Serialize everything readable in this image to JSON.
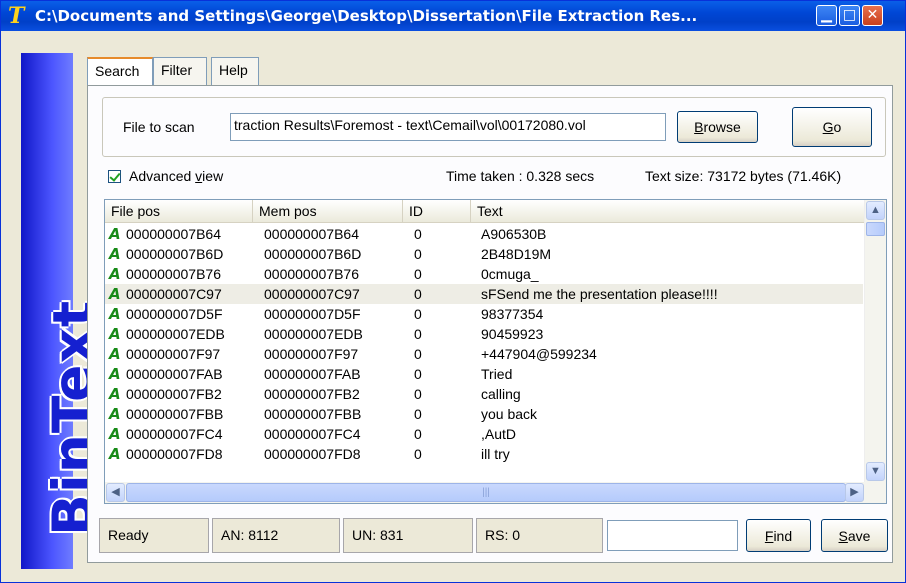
{
  "window": {
    "title": "C:\\Documents and Settings\\George\\Desktop\\Dissertation\\File Extraction Res...",
    "app_icon_glyph": "T",
    "controls": {
      "minimize": "▁",
      "maximize": "□",
      "close": "✕"
    }
  },
  "sidebar": {
    "brand": "BinText",
    "color": "#1520d0"
  },
  "tabs": [
    {
      "label": "Search",
      "active": true
    },
    {
      "label": "Filter",
      "active": false
    },
    {
      "label": "Help",
      "active": false
    }
  ],
  "scan": {
    "file_label": "File to scan",
    "file_value": "traction Results\\Foremost - text\\Cemail\\vol\\00172080.vol",
    "browse_label_u": "B",
    "browse_label_rest": "rowse",
    "go_label_u": "G",
    "go_label_rest": "o"
  },
  "options": {
    "advanced_view_pre": "Advanced ",
    "advanced_view_u": "v",
    "advanced_view_post": "iew",
    "advanced_view_checked": true,
    "time_taken": "Time taken : 0.328 secs",
    "text_size": "Text size: 73172 bytes (71.46K)"
  },
  "table": {
    "columns": [
      "File pos",
      "Mem pos",
      "ID",
      "Text"
    ],
    "type_glyph": "A",
    "rows": [
      {
        "file_pos": "000000007B64",
        "mem_pos": "000000007B64",
        "id": "0",
        "text": "A906530B"
      },
      {
        "file_pos": "000000007B6D",
        "mem_pos": "000000007B6D",
        "id": "0",
        "text": "2B48D19M"
      },
      {
        "file_pos": "000000007B76",
        "mem_pos": "000000007B76",
        "id": "0",
        "text": "0cmuga_"
      },
      {
        "file_pos": "000000007C97",
        "mem_pos": "000000007C97",
        "id": "0",
        "text": "sFSend me the presentation please!!!!"
      },
      {
        "file_pos": "000000007D5F",
        "mem_pos": "000000007D5F",
        "id": "0",
        "text": "98377354"
      },
      {
        "file_pos": "000000007EDB",
        "mem_pos": "000000007EDB",
        "id": "0",
        "text": "90459923"
      },
      {
        "file_pos": "000000007F97",
        "mem_pos": "000000007F97",
        "id": "0",
        "text": "+447904@599234"
      },
      {
        "file_pos": "000000007FAB",
        "mem_pos": "000000007FAB",
        "id": "0",
        "text": "Tried"
      },
      {
        "file_pos": "000000007FB2",
        "mem_pos": "000000007FB2",
        "id": "0",
        "text": "calling"
      },
      {
        "file_pos": "000000007FBB",
        "mem_pos": "000000007FBB",
        "id": "0",
        "text": "you back"
      },
      {
        "file_pos": "000000007FC4",
        "mem_pos": "000000007FC4",
        "id": "0",
        "text": ",AutD"
      },
      {
        "file_pos": "000000007FD8",
        "mem_pos": "000000007FD8",
        "id": "0",
        "text": "ill try"
      }
    ],
    "selected_row_index": 3,
    "scroll_up_glyph": "▲",
    "scroll_down_glyph": "▼",
    "scroll_left_glyph": "◀",
    "scroll_right_glyph": "▶",
    "hthumb_grip": "|||"
  },
  "status": {
    "state": "Ready",
    "an": "AN: 8112",
    "un": "UN: 831",
    "rs": "RS: 0",
    "find_value": "",
    "find_label_u": "F",
    "find_label_rest": "ind",
    "save_label_u": "S",
    "save_label_rest": "ave"
  }
}
